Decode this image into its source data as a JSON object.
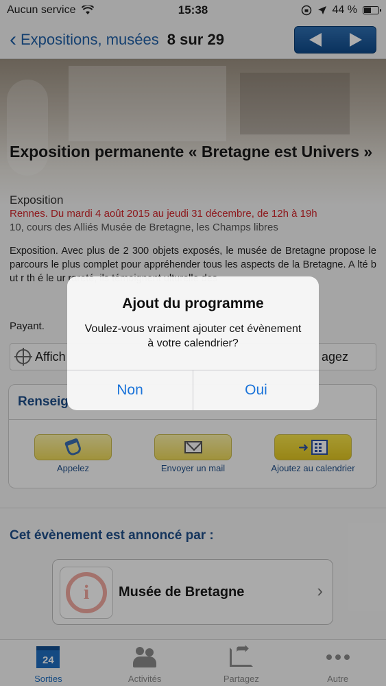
{
  "status_bar": {
    "carrier": "Aucun service",
    "time": "15:38",
    "battery": "44 %"
  },
  "nav": {
    "back_label": "Expositions, musées",
    "position": "8 sur 29"
  },
  "event": {
    "title": "Exposition permanente « Bretagne est Univers »",
    "type": "Exposition",
    "dates": "Rennes. Du mardi 4 août 2015 au jeudi 31 décembre, de 12h à 19h",
    "address": "10, cours des Alliés Musée de Bretagne, les Champs libres",
    "description": "Exposition. Avec plus de 2 300 objets exposés, le musée de Bretagne propose le parcours le plus complet pour appréhender tous les aspects de la Bretagne.    A    lté    b    ut        r    th    é    le          ur rareté, ils témoignent                                                              ulturelle des",
    "price": "Payant."
  },
  "actions": {
    "map_label": "Affich",
    "share_label": "agez"
  },
  "info_card": {
    "title": "Renseig",
    "buttons": [
      {
        "label": "Appelez"
      },
      {
        "label": "Envoyer un mail"
      },
      {
        "label": "Ajoutez au calendrier"
      }
    ]
  },
  "announce": {
    "title": "Cet évènement est annoncé par :",
    "museum_name": "Musée de Bretagne"
  },
  "tab_bar": {
    "tabs": [
      {
        "label": "Sorties",
        "icon_text": "24"
      },
      {
        "label": "Activités"
      },
      {
        "label": "Partagez"
      },
      {
        "label": "Autre"
      }
    ]
  },
  "alert": {
    "title": "Ajout du programme",
    "message": "Voulez-vous vraiment ajouter cet évènement à votre calendrier?",
    "cancel": "Non",
    "confirm": "Oui"
  }
}
